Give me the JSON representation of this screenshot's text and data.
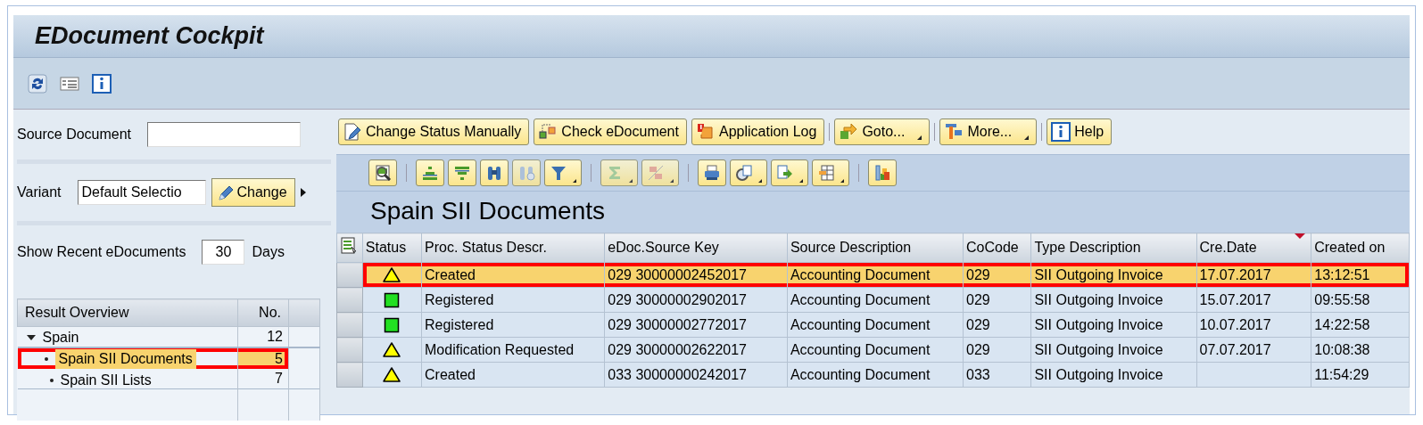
{
  "window": {
    "title": "EDocument Cockpit"
  },
  "source_document": {
    "label": "Source Document"
  },
  "variant": {
    "label": "Variant",
    "value": "Default Selectio",
    "button": "Change"
  },
  "recent": {
    "label": "Show Recent eDocuments",
    "value": "30",
    "unit": "Days"
  },
  "result_overview": {
    "columns": [
      "Result Overview",
      "No."
    ],
    "items": [
      {
        "label": "Spain",
        "count": "12",
        "expanded": true,
        "selected": false,
        "highlighted": false,
        "children": [
          {
            "label": "Spain SII Documents",
            "count": "5",
            "selected": true,
            "highlighted": true
          },
          {
            "label": "Spain SII Lists",
            "count": "7",
            "selected": false,
            "highlighted": false
          }
        ]
      }
    ]
  },
  "actions": [
    {
      "label": "Change Status Manually",
      "dropdown": false
    },
    {
      "label": "Check eDocument",
      "dropdown": false
    },
    {
      "label": "Application Log",
      "dropdown": false
    },
    {
      "label": "Goto...",
      "dropdown": true
    },
    {
      "label": "More...",
      "dropdown": true
    },
    {
      "label": "Help",
      "dropdown": false
    }
  ],
  "list": {
    "title": "Spain SII Documents",
    "status_column": {
      "label": "Status"
    },
    "columns": [
      {
        "label": "Proc. Status Descr.",
        "sorted": false
      },
      {
        "label": "eDoc.Source Key",
        "sorted": false
      },
      {
        "label": "Source Description",
        "sorted": false
      },
      {
        "label": "CoCode",
        "sorted": false
      },
      {
        "label": "Type Description",
        "sorted": false
      },
      {
        "label": "Cre.Date",
        "sorted": true
      },
      {
        "label": "Created on",
        "sorted": false
      }
    ],
    "rows": [
      {
        "kind": "warning",
        "cells": [
          "Created",
          "029 30000002452017",
          "Accounting Document",
          "029",
          "SII Outgoing Invoice",
          "17.07.2017",
          "13:12:51"
        ],
        "selected": true,
        "highlighted": true
      },
      {
        "kind": "ok",
        "cells": [
          "Registered",
          "029 30000002902017",
          "Accounting Document",
          "029",
          "SII Outgoing Invoice",
          "15.07.2017",
          "09:55:58"
        ],
        "selected": false,
        "highlighted": false
      },
      {
        "kind": "ok",
        "cells": [
          "Registered",
          "029 30000002772017",
          "Accounting Document",
          "029",
          "SII Outgoing Invoice",
          "10.07.2017",
          "14:22:58"
        ],
        "selected": false,
        "highlighted": false
      },
      {
        "kind": "warning",
        "cells": [
          "Modification Requested",
          "029 30000002622017",
          "Accounting Document",
          "029",
          "SII Outgoing Invoice",
          "07.07.2017",
          "10:08:38"
        ],
        "selected": false,
        "highlighted": false
      },
      {
        "kind": "warning",
        "cells": [
          "Created",
          "033 30000000242017",
          "Accounting Document",
          "033",
          "SII Outgoing Invoice",
          null,
          "11:54:29"
        ],
        "selected": false,
        "highlighted": false
      }
    ]
  }
}
